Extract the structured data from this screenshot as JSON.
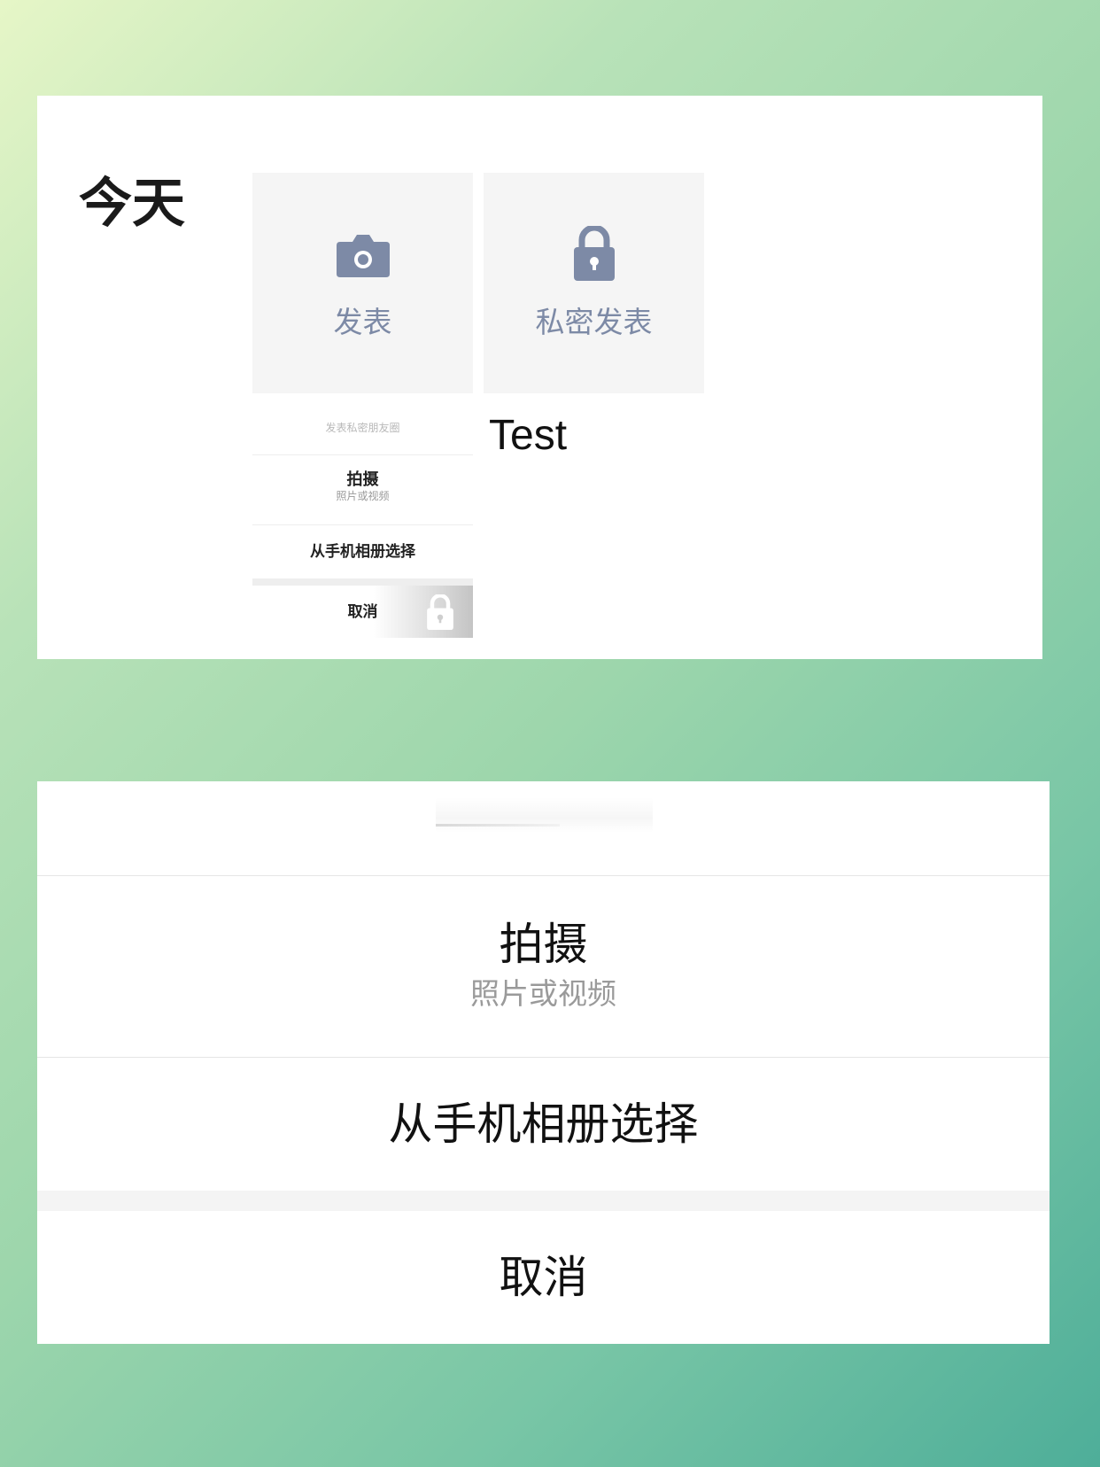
{
  "moments": {
    "day_label": "今天",
    "post_tile": {
      "label": "发表",
      "icon": "camera-icon"
    },
    "private_tile": {
      "label": "私密发表",
      "icon": "lock-icon"
    },
    "test_label": "Test",
    "mini_sheet": {
      "header": "发表私密朋友圈",
      "shoot_label": "拍摄",
      "shoot_sub": "照片或视频",
      "album_label": "从手机相册选择",
      "cancel_label": "取消",
      "icon": "lock-icon"
    }
  },
  "action_sheet": {
    "shoot_label": "拍摄",
    "shoot_sub": "照片或视频",
    "album_label": "从手机相册选择",
    "cancel_label": "取消"
  },
  "colors": {
    "icon_accent": "#7d8aa6",
    "tile_bg": "#f5f5f5"
  }
}
